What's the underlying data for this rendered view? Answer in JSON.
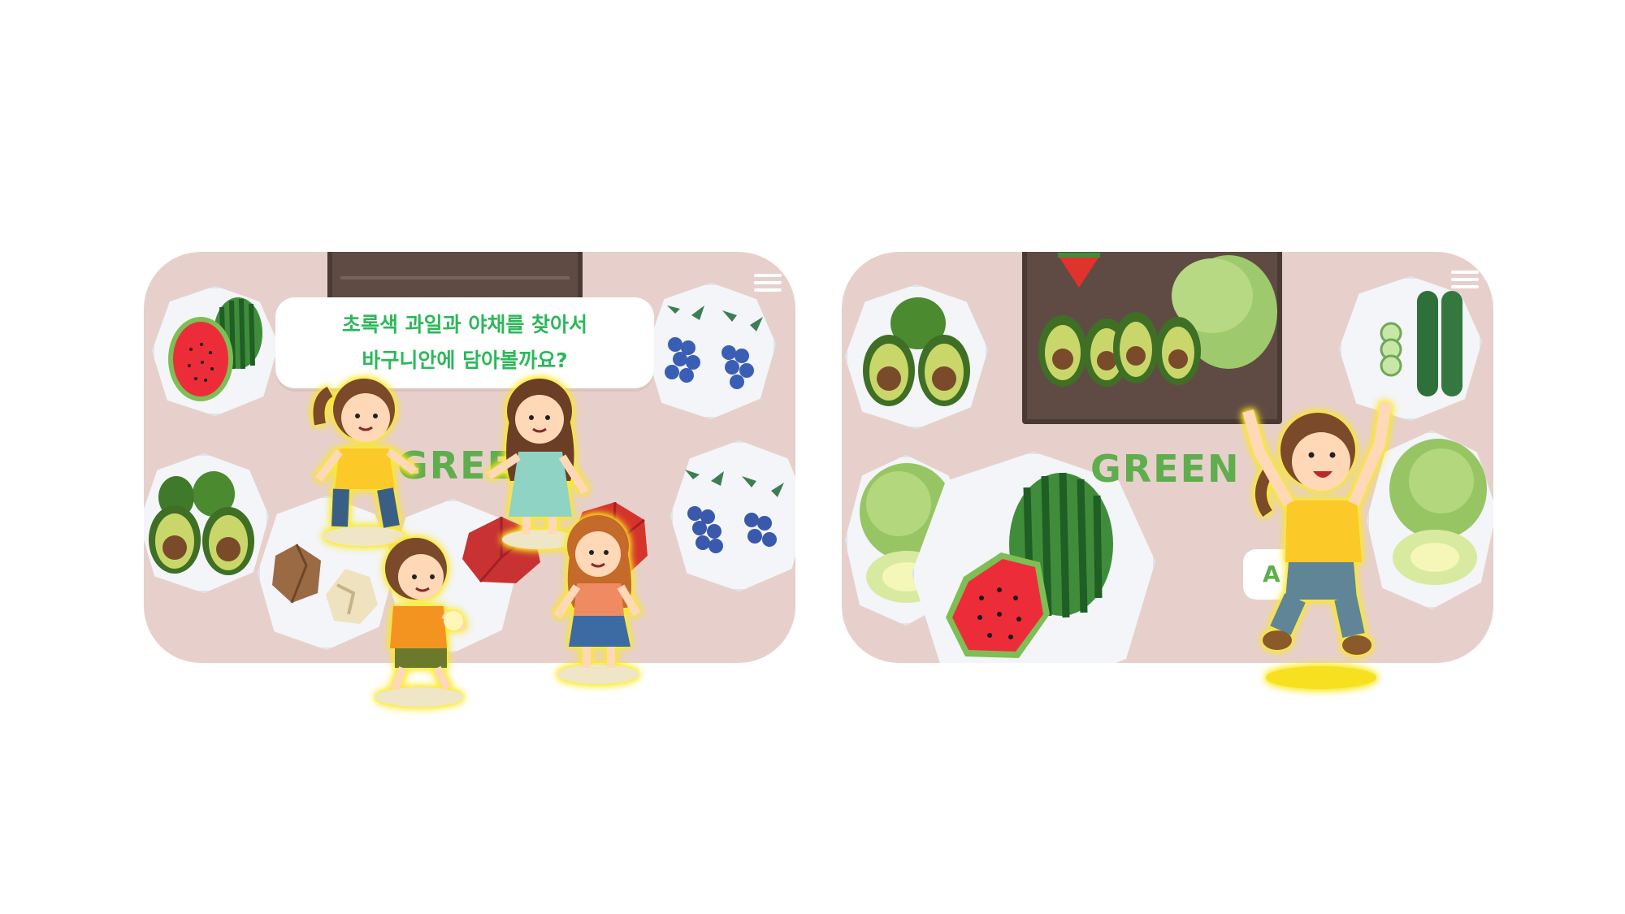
{
  "left_scene": {
    "speech_line1": "초록색 과일과 야채를 찾아서",
    "speech_line2": "바구니안에 담아볼까요?",
    "sign_text": "GREEN"
  },
  "right_scene": {
    "sign_text": "GREEN",
    "partial_button_text": "A"
  },
  "colors": {
    "panel_bg": "#e7d0cb",
    "speech_text": "#2db75a",
    "sign_text": "#5fae4e",
    "glow": "#f7f03a"
  },
  "icons": [
    "menu-icon",
    "watermelon-icon",
    "avocado-icon",
    "blueberry-icon",
    "onion-icon",
    "apple-icon",
    "cabbage-icon",
    "cucumber-icon"
  ]
}
